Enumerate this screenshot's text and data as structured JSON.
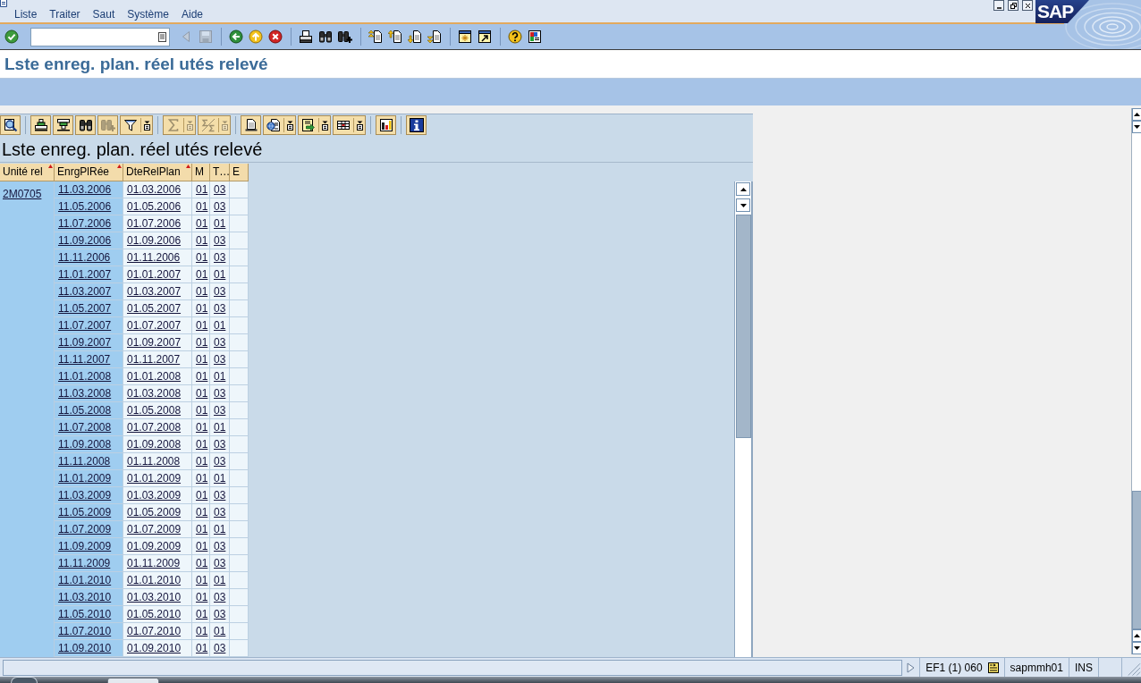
{
  "menu_bar": {
    "items": [
      "Liste",
      "Traiter",
      "Saut",
      "Système",
      "Aide"
    ]
  },
  "window_controls": [
    {
      "kind": "minimize"
    },
    {
      "kind": "restore"
    },
    {
      "kind": "close"
    }
  ],
  "logo": "SAP",
  "system_toolbar": {
    "groups": [
      [
        {
          "kind": "enter",
          "disabled": false
        },
        {
          "kind": "command",
          "disabled": false
        },
        {
          "kind": "previous",
          "disabled": true
        },
        {
          "kind": "save",
          "disabled": true
        }
      ],
      [
        {
          "kind": "back",
          "disabled": false
        },
        {
          "kind": "exit",
          "disabled": false
        },
        {
          "kind": "cancel",
          "disabled": false
        }
      ],
      [
        {
          "kind": "print",
          "disabled": false
        },
        {
          "kind": "find",
          "disabled": false
        },
        {
          "kind": "findnext",
          "disabled": false
        }
      ],
      [
        {
          "kind": "firstpage",
          "disabled": false
        },
        {
          "kind": "prevpage",
          "disabled": false
        },
        {
          "kind": "nextpage",
          "disabled": false
        },
        {
          "kind": "lastpage",
          "disabled": false
        }
      ],
      [
        {
          "kind": "session",
          "disabled": false
        },
        {
          "kind": "shortcut",
          "disabled": false
        }
      ],
      [
        {
          "kind": "help",
          "disabled": false
        },
        {
          "kind": "customize",
          "disabled": false
        }
      ]
    ]
  },
  "title": "Lste enreg. plan. réel utés relevé",
  "alv": {
    "toolbar": [
      [
        {
          "kind": "details",
          "disabled": false,
          "dropdown": false
        }
      ],
      [
        {
          "kind": "sortup",
          "disabled": false,
          "dropdown": false
        },
        {
          "kind": "sortdown",
          "disabled": false,
          "dropdown": false
        },
        {
          "kind": "find",
          "disabled": false,
          "dropdown": false
        },
        {
          "kind": "findnext",
          "disabled": true,
          "dropdown": false
        },
        {
          "kind": "filter",
          "disabled": false,
          "dropdown": true
        }
      ],
      [
        {
          "kind": "total",
          "disabled": true,
          "dropdown": true
        },
        {
          "kind": "subtotal",
          "disabled": true,
          "dropdown": true
        }
      ],
      [
        {
          "kind": "preview",
          "disabled": false,
          "dropdown": false
        },
        {
          "kind": "views",
          "disabled": false,
          "dropdown": true
        },
        {
          "kind": "export",
          "disabled": false,
          "dropdown": true
        },
        {
          "kind": "layout",
          "disabled": false,
          "dropdown": true
        }
      ],
      [
        {
          "kind": "graphic",
          "disabled": false,
          "dropdown": false
        }
      ],
      [
        {
          "kind": "info",
          "disabled": false,
          "dropdown": false
        }
      ]
    ],
    "title": "Lste enreg. plan. réel utés relevé",
    "columns": [
      {
        "label": "Unité rel",
        "key": true,
        "sorted": true
      },
      {
        "label": "EnrgPlRée",
        "key": true,
        "sorted": true
      },
      {
        "label": "DteRelPlan",
        "key": false,
        "sorted": true
      },
      {
        "label": "M",
        "key": false,
        "sorted": false
      },
      {
        "label": "T…",
        "key": false,
        "sorted": false
      },
      {
        "label": "E",
        "key": false,
        "sorted": false
      }
    ],
    "groups": [
      {
        "unit": "2M0705",
        "rows": [
          [
            "11.03.2006",
            "01.03.2006",
            "01",
            "03"
          ],
          [
            "11.05.2006",
            "01.05.2006",
            "01",
            "03"
          ],
          [
            "11.07.2006",
            "01.07.2006",
            "01",
            "01"
          ],
          [
            "11.09.2006",
            "01.09.2006",
            "01",
            "03"
          ],
          [
            "11.11.2006",
            "01.11.2006",
            "01",
            "03"
          ],
          [
            "11.01.2007",
            "01.01.2007",
            "01",
            "01"
          ],
          [
            "11.03.2007",
            "01.03.2007",
            "01",
            "03"
          ],
          [
            "11.05.2007",
            "01.05.2007",
            "01",
            "03"
          ],
          [
            "11.07.2007",
            "01.07.2007",
            "01",
            "01"
          ],
          [
            "11.09.2007",
            "01.09.2007",
            "01",
            "03"
          ],
          [
            "11.11.2007",
            "01.11.2007",
            "01",
            "03"
          ],
          [
            "11.01.2008",
            "01.01.2008",
            "01",
            "01"
          ],
          [
            "11.03.2008",
            "01.03.2008",
            "01",
            "03"
          ],
          [
            "11.05.2008",
            "01.05.2008",
            "01",
            "03"
          ],
          [
            "11.07.2008",
            "01.07.2008",
            "01",
            "01"
          ],
          [
            "11.09.2008",
            "01.09.2008",
            "01",
            "03"
          ],
          [
            "11.11.2008",
            "01.11.2008",
            "01",
            "03"
          ],
          [
            "11.01.2009",
            "01.01.2009",
            "01",
            "01"
          ],
          [
            "11.03.2009",
            "01.03.2009",
            "01",
            "03"
          ],
          [
            "11.05.2009",
            "01.05.2009",
            "01",
            "03"
          ],
          [
            "11.07.2009",
            "01.07.2009",
            "01",
            "01"
          ],
          [
            "11.09.2009",
            "01.09.2009",
            "01",
            "03"
          ],
          [
            "11.11.2009",
            "01.11.2009",
            "01",
            "03"
          ],
          [
            "11.01.2010",
            "01.01.2010",
            "01",
            "01"
          ],
          [
            "11.03.2010",
            "01.03.2010",
            "01",
            "03"
          ],
          [
            "11.05.2010",
            "01.05.2010",
            "01",
            "03"
          ],
          [
            "11.07.2010",
            "01.07.2010",
            "01",
            "01"
          ],
          [
            "11.09.2010",
            "01.09.2010",
            "01",
            "03"
          ]
        ]
      }
    ]
  },
  "status_bar": {
    "system": "EF1 (1) 060",
    "server": "sapmmh01",
    "mode": "INS"
  }
}
